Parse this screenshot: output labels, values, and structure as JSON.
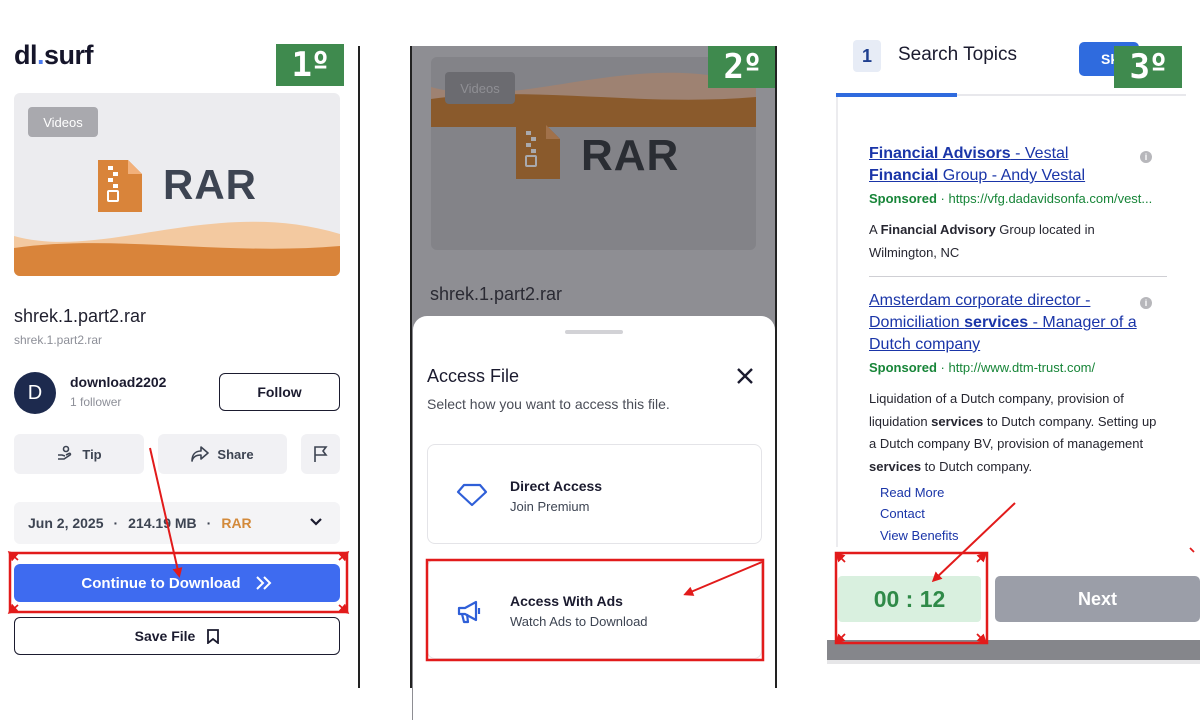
{
  "colors": {
    "step_badge": "#3f8a4e",
    "primary_blue": "#3e6bf0",
    "annotation_red": "#e21b1b",
    "rar_orange": "#d9843a",
    "sponsored_green": "#178538",
    "ad_link_blue": "#1a35a8"
  },
  "panel1": {
    "step_label": "1º",
    "logo_prefix": "dl",
    "logo_dot": ".",
    "logo_suffix": "surf",
    "thumbnail": {
      "chip": "Videos",
      "format": "RAR",
      "icon": "zip-file-icon"
    },
    "filename": "shrek.1.part2.rar",
    "filename_sub": "shrek.1.part2.rar",
    "uploader": {
      "avatar_letter": "D",
      "name": "download2202",
      "followers": "1 follower",
      "follow_label": "Follow"
    },
    "actions": {
      "tip_label": "Tip",
      "share_label": "Share",
      "report_icon": "flag-icon"
    },
    "meta": {
      "date": "Jun 2, 2025",
      "sep": "·",
      "size": "214.19 MB",
      "format": "RAR",
      "expand_icon": "chevron-down-icon"
    },
    "continue_label": "Continue to Download",
    "continue_icon": "double-chevron-right-icon",
    "save_label": "Save File",
    "save_icon": "bookmark-icon"
  },
  "panel2": {
    "step_label": "2º",
    "thumbnail": {
      "chip": "Videos",
      "format": "RAR"
    },
    "filename": "shrek.1.part2.rar",
    "sheet": {
      "title": "Access File",
      "subtitle": "Select how you want to access this file.",
      "close_icon": "close-icon",
      "options": [
        {
          "icon": "diamond-icon",
          "title": "Direct Access",
          "subtitle": "Join Premium"
        },
        {
          "icon": "megaphone-icon",
          "title": "Access With Ads",
          "subtitle": "Watch Ads to Download"
        }
      ]
    }
  },
  "panel3": {
    "step_label": "3º",
    "step_number": "1",
    "step_title": "Search Topics",
    "skip_label": "Sk",
    "ads": [
      {
        "title_a": "Financial Advisors",
        "title_b": " - Vestal ",
        "title_c": "Financial",
        "title_d": " Group - Andy Vestal",
        "sponsored": "Sponsored",
        "dot": " · ",
        "url": "https://vfg.dadavidsonfa.com/vest...",
        "desc_a": "A ",
        "desc_b": "Financial Advisory",
        "desc_c": " Group located in Wilmington, NC"
      },
      {
        "title_a": "Amsterdam corporate director - Domiciliation ",
        "title_b": "services",
        "title_c": " - Manager of a Dutch company",
        "sponsored": "Sponsored",
        "dot": " · ",
        "url": "http://www.dtm-trust.com/",
        "desc_a": "Liquidation of a Dutch company, provision of liquidation ",
        "desc_b": "services",
        "desc_c": " to Dutch company. Setting up a Dutch company BV, provision of management ",
        "desc_d": "services",
        "desc_e": " to Dutch company.",
        "links": [
          "Read More",
          "Contact",
          "View Benefits"
        ]
      }
    ],
    "info_icon": "info-icon",
    "timer": "00 : 12",
    "next_label": "Next"
  }
}
